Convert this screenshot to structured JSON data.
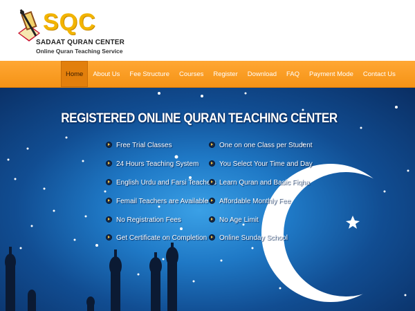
{
  "brand": {
    "logo_text": "SQC",
    "name": "SADAAT QURAN CENTER",
    "tagline": "Online Quran Teaching Service"
  },
  "nav": {
    "items": [
      {
        "label": "Home",
        "active": true
      },
      {
        "label": "About Us"
      },
      {
        "label": "Fee Structure"
      },
      {
        "label": "Courses"
      },
      {
        "label": "Register"
      },
      {
        "label": "Download"
      },
      {
        "label": "FAQ"
      },
      {
        "label": "Payment Mode"
      },
      {
        "label": "Contact Us"
      }
    ]
  },
  "hero": {
    "title": "REGISTERED ONLINE QURAN TEACHING CENTER",
    "features_left": [
      "Free Trial Classes",
      "24 Hours Teaching System",
      "English Urdu and Farsi Teachers",
      "Femail Teachers are Available",
      "No Registration Fees",
      "Get Certificate on Completion"
    ],
    "features_right": [
      "One on one Class per Student",
      "You Select Your Time and Day",
      "Learn Quran and Basic Fiqha",
      "Affordable Monthly Fee",
      "No Age Limit",
      "Online Sunday School"
    ]
  },
  "colors": {
    "nav_orange": "#f59316",
    "logo_gold": "#f2b400",
    "sky_blue": "#1f79c6"
  }
}
